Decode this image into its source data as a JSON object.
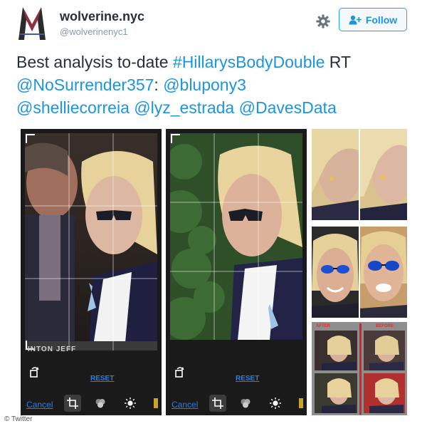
{
  "header": {
    "display_name": "wolverine.nyc",
    "handle": "@wolverinenyc1",
    "follow_label": "Follow"
  },
  "tweet": {
    "prefix": "Best analysis to-date ",
    "hashtag": "#HillarysBodyDouble",
    "rt": " RT",
    "mention1": "@NoSurrender357",
    "colon": ": ",
    "mention2": "@blupony3",
    "mention3": "@shelliecorreia",
    "mention4": "@lyz_estrada",
    "mention5": "@DavesData"
  },
  "media": {
    "left_phone": {
      "reset_label": "RESET",
      "cancel_label": "Cancel",
      "banner_text": "INTON JEFF"
    },
    "right_phone": {
      "reset_label": "RESET",
      "cancel_label": "Cancel"
    },
    "comparison": {
      "after_label": "AFTER",
      "before_label": "BEFORE"
    }
  },
  "icons": {
    "gear": "gear-icon",
    "follow": "add-user-icon",
    "rotate": "rotate-icon",
    "crop": "crop-icon",
    "filters": "filters-icon",
    "brightness": "brightness-icon"
  },
  "footer": {
    "watermark": "© Twitter"
  },
  "colors": {
    "link": "#1b95e0",
    "follow_border": "#1da1f2",
    "phone_bg": "#1a1a1a"
  }
}
